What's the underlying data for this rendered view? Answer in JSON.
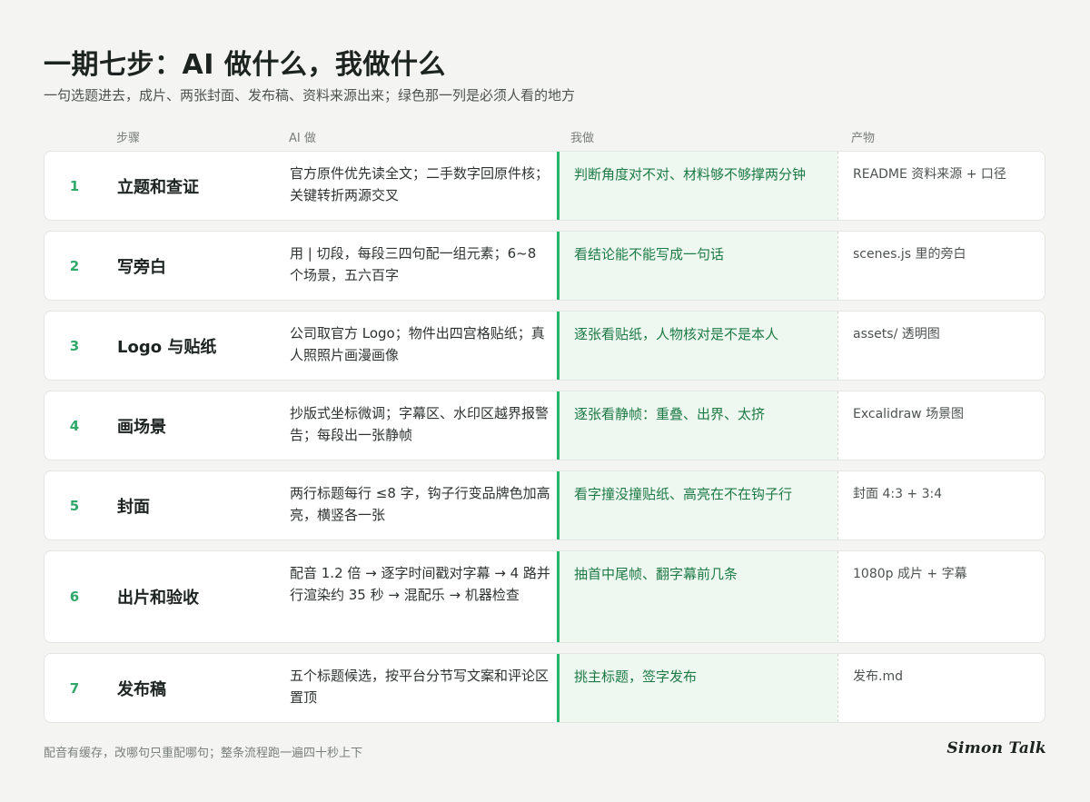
{
  "header": {
    "title": "一期七步：AI 做什么，我做什么",
    "subtitle": "一句选题进去，成片、两张封面、发布稿、资料来源出来；绿色那一列是必须人看的地方"
  },
  "columns": {
    "step": "步骤",
    "ai": "AI 做",
    "me": "我做",
    "output": "产物"
  },
  "rows": [
    {
      "num": "1",
      "step": "立题和查证",
      "ai": "官方原件优先读全文；二手数字回原件核；关键转折两源交叉",
      "me": "判断角度对不对、材料够不够撑两分钟",
      "output": "README 资料来源 + 口径"
    },
    {
      "num": "2",
      "step": "写旁白",
      "ai": "用 | 切段，每段三四句配一组元素；6~8 个场景，五六百字",
      "me": "看结论能不能写成一句话",
      "output": "scenes.js 里的旁白"
    },
    {
      "num": "3",
      "step": "Logo 与贴纸",
      "ai": "公司取官方 Logo；物件出四宫格贴纸；真人照照片画漫画像",
      "me": "逐张看贴纸，人物核对是不是本人",
      "output": "assets/ 透明图"
    },
    {
      "num": "4",
      "step": "画场景",
      "ai": "抄版式坐标微调；字幕区、水印区越界报警告；每段出一张静帧",
      "me": "逐张看静帧：重叠、出界、太挤",
      "output": "Excalidraw 场景图"
    },
    {
      "num": "5",
      "step": "封面",
      "ai": "两行标题每行 ≤8 字，钩子行变品牌色加高亮，横竖各一张",
      "me": "看字撞没撞贴纸、高亮在不在钩子行",
      "output": "封面 4:3 + 3:4"
    },
    {
      "num": "6",
      "step": "出片和验收",
      "ai": "配音 1.2 倍 → 逐字时间戳对字幕 → 4 路并行渲染约 35 秒 → 混配乐 → 机器检查",
      "me": "抽首中尾帧、翻字幕前几条",
      "output": "1080p 成片 + 字幕"
    },
    {
      "num": "7",
      "step": "发布稿",
      "ai": "五个标题候选，按平台分节写文案和评论区置顶",
      "me": "挑主标题，签字发布",
      "output": "发布.md"
    }
  ],
  "footer": {
    "note": "配音有缓存，改哪句只重配哪句；整条流程跑一遍四十秒上下",
    "signature": "Simon Talk"
  },
  "colors": {
    "accent_green": "#27b56b",
    "me_column_bg": "#eef8f0",
    "me_text": "#1d7a45",
    "page_bg": "#f4f4f2"
  }
}
